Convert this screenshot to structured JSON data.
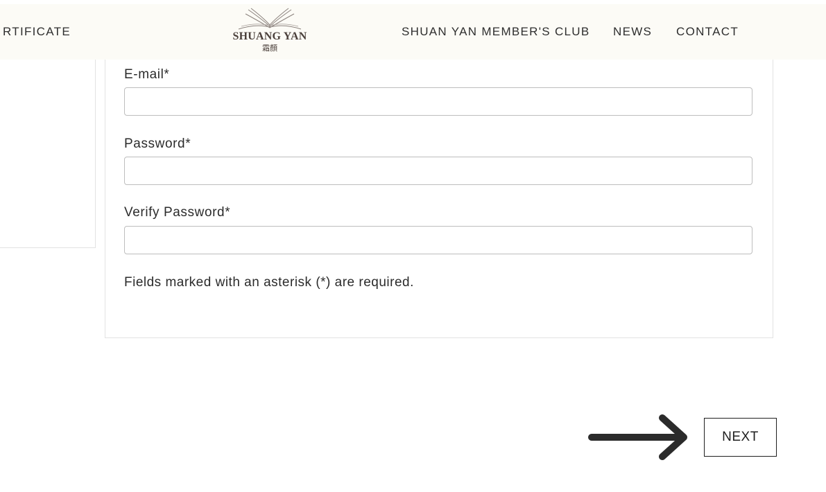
{
  "header": {
    "nav_left": "RTIFICATE",
    "logo": {
      "name": "SHUANG YAN",
      "subtitle": "霜顏"
    },
    "nav_right": [
      "SHUAN YAN MEMBER'S CLUB",
      "NEWS",
      "CONTACT"
    ]
  },
  "form": {
    "email_label": "E-mail*",
    "email_value": "",
    "password_label": "Password*",
    "password_value": "",
    "verify_password_label": "Verify Password*",
    "verify_password_value": "",
    "required_note": "Fields marked with an asterisk (*) are required."
  },
  "actions": {
    "next_label": "NEXT",
    "arrow_icon": "arrow-right-icon"
  },
  "colors": {
    "header_bg": "#fcfbf6",
    "text": "#2b2b2b",
    "border": "#e2e2e2",
    "input_border": "#bdbdbd",
    "arrow": "#2b2b2b"
  }
}
